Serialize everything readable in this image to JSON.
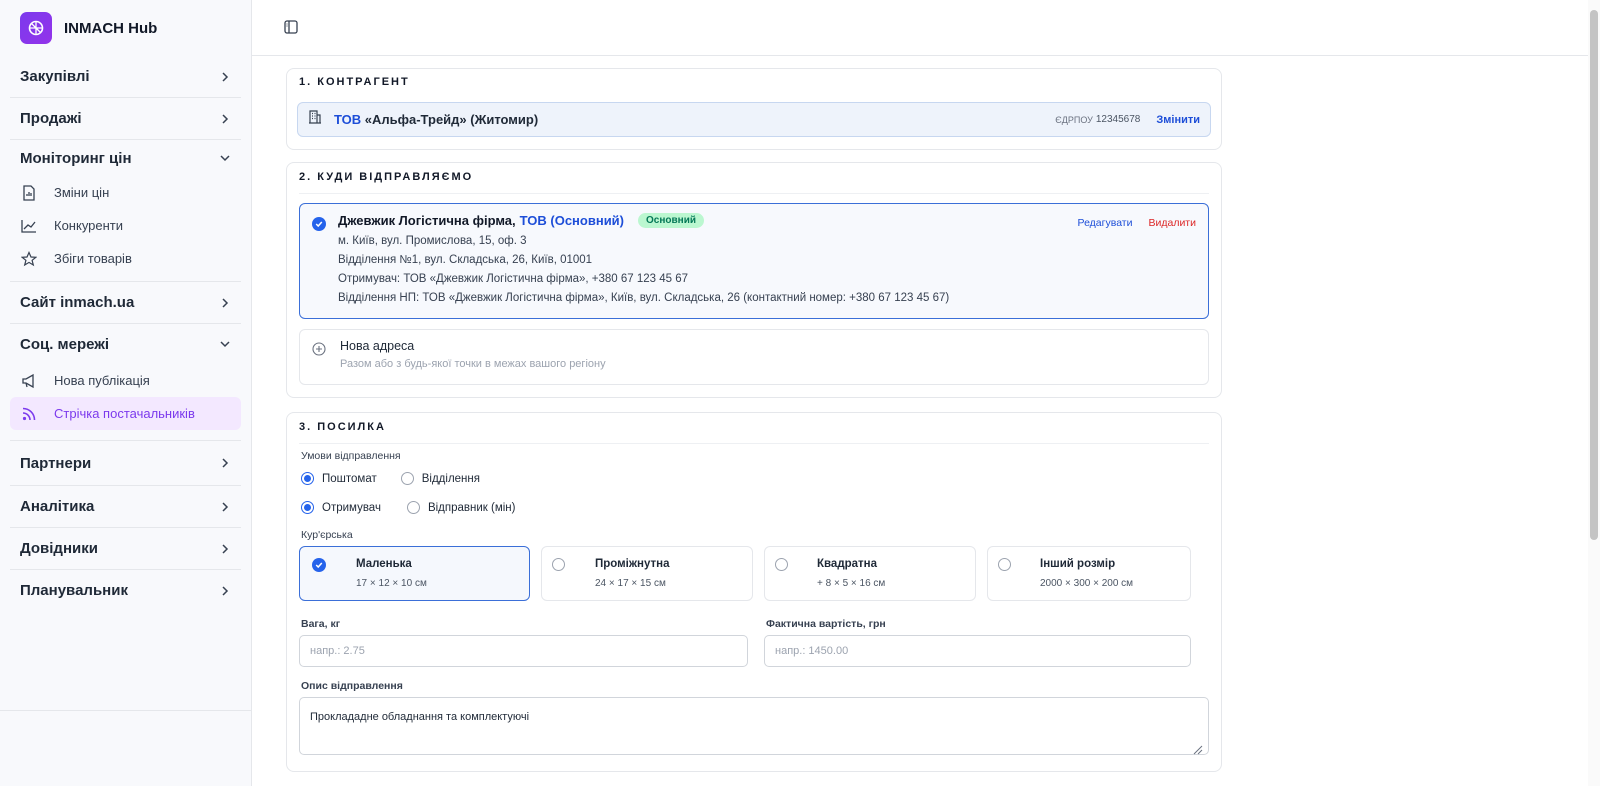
{
  "brand": {
    "name": "INMACH Hub"
  },
  "sidebar": {
    "groups": [
      {
        "label": "Закупівлі"
      },
      {
        "label": "Продажі"
      },
      {
        "label": "Моніторинг цін",
        "items": [
          "Зміни цін",
          "Конкуренти",
          "Збіги товарів"
        ]
      },
      {
        "label": "Сайт inmach.ua"
      },
      {
        "label": "Соц. мережі",
        "items": [
          "Нова публікація",
          "Стрічка постачальників"
        ]
      },
      {
        "label": "Партнери"
      },
      {
        "label": "Аналітика"
      },
      {
        "label": "Довідники"
      },
      {
        "label": "Планувальник"
      }
    ],
    "active_item": "Стрічка постачальників",
    "accent_color": "#7c3aed"
  },
  "section1": {
    "title": "1. КОНТРАГЕНТ",
    "party_prefix": "ТОВ",
    "party_name": "«Альфа-Трейд» (Житомир)",
    "edrpou_label": "ЄДРПОУ",
    "edrpou_value": "12345678",
    "change_label": "Змінити"
  },
  "section2": {
    "title": "2. КУДИ ВІДПРАВЛЯЄМО",
    "address": {
      "name": "Джевжик Логістична фірма,",
      "name_suffix": "ТОВ (Основний)",
      "badge": "Основний",
      "lines": [
        "м. Київ, вул. Промислова, 15, оф. 3",
        "Відділення №1, вул. Складська, 26, Київ, 01001",
        "Отримувач: ТОВ «Джевжик Логістична фірма», +380 67 123 45 67",
        "Відділення НП: ТОВ «Джевжик Логістична фірма», Київ, вул. Складська, 26 (контактний номер: +380 67 123 45 67)"
      ],
      "edit_label": "Редагувати",
      "delete_label": "Видалити"
    },
    "new_address": {
      "title": "Нова адреса",
      "subtitle": "Разом або з будь-якої точки в межах вашого регіону"
    }
  },
  "section3": {
    "title": "3. ПОСИЛКА",
    "conditions_label": "Умови відправлення",
    "delivery_options": [
      "Поштомат",
      "Відділення"
    ],
    "payer_options": [
      "Отримувач",
      "Відправник (мін)"
    ],
    "courier_label": "Кур'єрська",
    "sizes": [
      {
        "name": "Маленька",
        "dims": "17 × 12 × 10 см",
        "selected": true
      },
      {
        "name": "Проміжнутна",
        "dims": "24 × 17 × 15 см",
        "selected": false
      },
      {
        "name": "Квадратна",
        "dims": "+ 8 × 5 × 16 см",
        "selected": false
      },
      {
        "name": "Інший розмір",
        "dims": "2000 × 300 × 200 см",
        "selected": false
      }
    ],
    "weight_label": "Вага, кг",
    "weight_placeholder": "напр.: 2.75",
    "cost_label": "Фактична вартість, грн",
    "cost_placeholder": "напр.: 1450.00",
    "description_label": "Опис відправлення",
    "description_value": "Проклададне обладнання та комплектуючі"
  }
}
